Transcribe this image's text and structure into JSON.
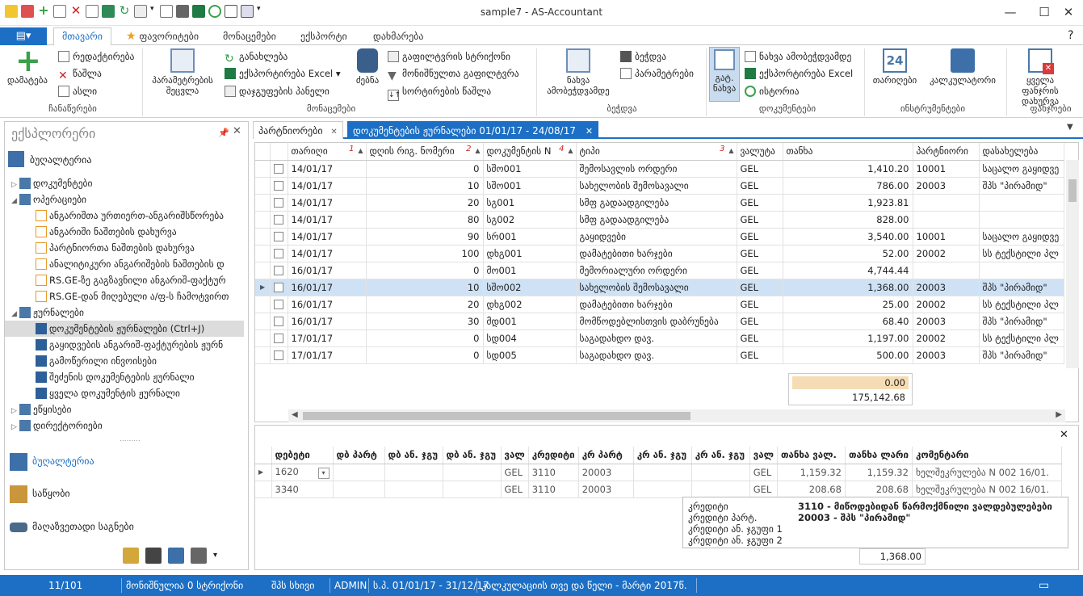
{
  "window": {
    "title": "sample7 - AS-Accountant"
  },
  "ribbon_tabs": [
    "მთავარი",
    "ფავორიტები",
    "მონაცემები",
    "ექსპორტი",
    "დახმარება"
  ],
  "ribbon": {
    "groups": {
      "records": "ჩანაწერები",
      "data": "მონაცემები",
      "print": "ბეჭდვა",
      "documents": "დოკუმენტები",
      "tools": "ინსტრუმენტები",
      "windows": "ფანჯრები"
    },
    "add": "დამატება",
    "edit": "რედაქტირება",
    "delete": "წაშლა",
    "copy": "ასლი",
    "param_change": "პარამეტრების შეცვლა",
    "refresh": "განახლება",
    "export_excel": "ექსპორტირება Excel",
    "group_panel": "დაჯგუფების პანელი",
    "search": "ძებნა",
    "filter_row": "გაფილტვრის სტრიქონი",
    "filter_selected": "მონიშნულთა გაფილტვრა",
    "sort_delete": "სორტირების წაშლა",
    "preview_find": "ნახვა ამობეჭდვამდე",
    "print": "ბეჭდვა",
    "print_params": "პარამეტრები",
    "document_view": "გატ. ნახვა",
    "doc_preview": "ნახვა ამობეჭდვამდე",
    "doc_export": "ექსპორტირება Excel",
    "history": "ისტორია",
    "calendar": "თარიღები",
    "calendar_day": "24",
    "calculator": "კალკულატორი",
    "close_all": "ყველა ფანჯრის დახურვა"
  },
  "explorer": {
    "title": "ექსპლორერი",
    "root": "ბუღალტერია",
    "items": [
      {
        "label": "დოკუმენტები",
        "level": 1,
        "arrow": "▷"
      },
      {
        "label": "ოპერაციები",
        "level": 1,
        "arrow": "◢"
      },
      {
        "label": "ანგარიშთა ურთიერთ-ანგარიშსწორება",
        "level": 2
      },
      {
        "label": "ანგარიში ნაშთების დახურვა",
        "level": 2
      },
      {
        "label": "პარტნიორთა ნაშთების დახურვა",
        "level": 2
      },
      {
        "label": "ანალიტიკური ანგარიშების ნაშთების დ",
        "level": 2
      },
      {
        "label": "RS.GE-ზე გაგზავნილი ანგარიშ-ფაქტურ",
        "level": 2
      },
      {
        "label": "RS.GE-დან მიღებული ა/ფ-ს ჩამოტვირთ",
        "level": 2
      },
      {
        "label": "ჟურნალები",
        "level": 1,
        "arrow": "◢"
      },
      {
        "label": "დოკუმენტების ჟურნალები (Ctrl+J)",
        "level": 2,
        "selected": true
      },
      {
        "label": "გაყიდვების ანგარიშ-ფაქტურების ჟურნ",
        "level": 2
      },
      {
        "label": "გამოწერილი ინვოისები",
        "level": 2
      },
      {
        "label": "შეძენის დოკუმენტების ჟურნალი",
        "level": 2
      },
      {
        "label": "ყველა დოკუმენტის ჟურნალი",
        "level": 2
      },
      {
        "label": "ეწყისები",
        "level": 1,
        "arrow": "▷"
      },
      {
        "label": "დირექტორიები",
        "level": 1,
        "arrow": "▷"
      }
    ],
    "nav": [
      "ბუღალტერია",
      "საწყობი",
      "მაღაზვეთადი საგნები"
    ]
  },
  "doc_tabs": [
    {
      "label": "პარტნიორები",
      "active": false
    },
    {
      "label": "დოკუმენტების ჟურნალები 01/01/17 - 24/08/17",
      "active": true
    }
  ],
  "grid": {
    "columns": [
      {
        "label": "თარიღი",
        "sort": "1"
      },
      {
        "label": "დღის რიგ. ნომერი",
        "sort": "2"
      },
      {
        "label": "დოკუმენტის N",
        "sort": "4"
      },
      {
        "label": "ტიპი",
        "sort": "3"
      },
      {
        "label": "ვალუტა",
        "sort": ""
      },
      {
        "label": "თანხა",
        "sort": ""
      },
      {
        "label": "პარტნიორი",
        "sort": ""
      },
      {
        "label": "დასახელება",
        "sort": ""
      }
    ],
    "rows": [
      [
        "14/01/17",
        "0",
        "სშო001",
        "შემოსავლის ორდერი",
        "GEL",
        "1,410.20",
        "10001",
        "საცალო გაყიდვე"
      ],
      [
        "14/01/17",
        "10",
        "სშო001",
        "სახელობის შემოსავალი",
        "GEL",
        "786.00",
        "20003",
        "შპს \"პირამიდ\""
      ],
      [
        "14/01/17",
        "20",
        "სგ001",
        "სმფ გადაადგილება",
        "GEL",
        "1,923.81",
        "",
        ""
      ],
      [
        "14/01/17",
        "80",
        "სგ002",
        "სმფ გადაადგილება",
        "GEL",
        "828.00",
        "",
        ""
      ],
      [
        "14/01/17",
        "90",
        "სრ001",
        "გაყიდვები",
        "GEL",
        "3,540.00",
        "10001",
        "საცალო გაყიდვე"
      ],
      [
        "14/01/17",
        "100",
        "დხგ001",
        "დამატებითი ხარჯები",
        "GEL",
        "52.00",
        "20002",
        "სს ტექსტილი პლ"
      ],
      [
        "16/01/17",
        "0",
        "მო001",
        "მემორიალური ორდერი",
        "GEL",
        "4,744.44",
        "",
        ""
      ],
      [
        "16/01/17",
        "10",
        "სშო002",
        "სახელობის შემოსავალი",
        "GEL",
        "1,368.00",
        "20003",
        "შპს \"პირამიდ\""
      ],
      [
        "16/01/17",
        "20",
        "დხგ002",
        "დამატებითი ხარჯები",
        "GEL",
        "25.00",
        "20002",
        "სს ტექსტილი პლ"
      ],
      [
        "16/01/17",
        "30",
        "მდ001",
        "მომწოდებლისთვის დაბრუნება",
        "GEL",
        "68.40",
        "20003",
        "შპს \"პირამიდ\""
      ],
      [
        "17/01/17",
        "0",
        "სდ004",
        "საგადახდო დავ.",
        "GEL",
        "1,197.00",
        "20002",
        "სს ტექსტილი პლ"
      ],
      [
        "17/01/17",
        "0",
        "სდ005",
        "საგადახდო დავ.",
        "GEL",
        "500.00",
        "20003",
        "შპს \"პირამიდ\""
      ]
    ],
    "selected_row": 7,
    "totals": [
      "0.00",
      "175,142.68"
    ]
  },
  "lower": {
    "columns": [
      "დებეტი",
      "დბ პარტ",
      "დბ ან. ჯგუ",
      "დბ ან. ჯგუ",
      "ვალ",
      "კრედიტი",
      "კრ პარტ",
      "კრ ან. ჯგუ",
      "კრ ან. ჯგუ",
      "ვალ",
      "თანხა ვალ.",
      "თანხა ლარი",
      "კომენტარი"
    ],
    "rows": [
      [
        "1620",
        "",
        "",
        "",
        "GEL",
        "3110",
        "20003",
        "",
        "",
        "GEL",
        "1,159.32",
        "1,159.32",
        "ხელშეკრულება N 002 16/01."
      ],
      [
        "3340",
        "",
        "",
        "",
        "GEL",
        "3110",
        "20003",
        "",
        "",
        "GEL",
        "208.68",
        "208.68",
        "ხელშეკრულება N 002 16/01."
      ]
    ],
    "total": "1,368.00",
    "tooltip": {
      "labels": [
        "კრედიტი",
        "კრედიტი პარტ.",
        "კრედიტი ან. ჯგუფი 1",
        "კრედიტი ან. ჯგუფი 2"
      ],
      "values": [
        "3110 - მიწოდებიდან წარმოქმნილი ვალდებულებები",
        "20003 - შპს \"პირამიდ\"",
        "",
        ""
      ]
    }
  },
  "status": {
    "record": "11/101",
    "selected": "მონიშნულია 0 სტრიქონი",
    "company": "შპს სხივი",
    "user": "ADMIN",
    "period": "ს.პ. 01/01/17 - 31/12/17",
    "calc": "კალკულაციის თვე და წელი - მარტი 2017წ."
  },
  "colors": {
    "accent": "#1c6fc5",
    "selected_row": "#cfe2f5",
    "total_highlight": "#f6dcb4"
  }
}
